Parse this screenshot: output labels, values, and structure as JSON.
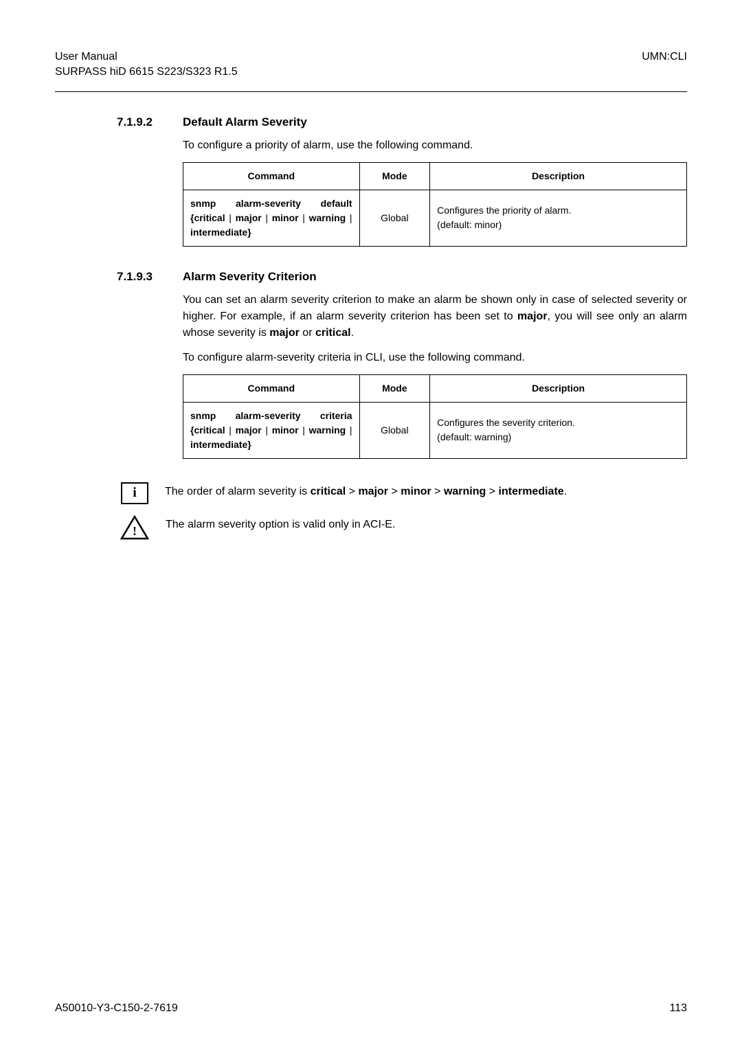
{
  "header": {
    "left_line1": "User Manual",
    "left_line2": "SURPASS hiD 6615 S223/S323 R1.5",
    "right": "UMN:CLI"
  },
  "section1": {
    "number": "7.1.9.2",
    "title": "Default Alarm Severity",
    "intro": "To configure a priority of alarm, use the following command.",
    "th_command": "Command",
    "th_mode": "Mode",
    "th_desc": "Description",
    "cmd_prefix": "snmp alarm-severity default {critical",
    "cmd_sep1": " | ",
    "cmd_major": "major",
    "cmd_sep2": " | ",
    "cmd_minor": "minor",
    "cmd_sep3": " | ",
    "cmd_warning": "warning",
    "cmd_sep4": " | ",
    "cmd_intermediate": "intermediate}",
    "mode": "Global",
    "desc_l1": "Configures the priority of alarm.",
    "desc_l2": "(default: minor)"
  },
  "section2": {
    "number": "7.1.9.3",
    "title": "Alarm Severity Criterion",
    "para1_a": "You can set an alarm severity criterion to make an alarm be shown only in case of selected severity or higher. For example, if an alarm severity criterion has been set to ",
    "para1_b": "major",
    "para1_c": ", you will see only an alarm whose severity is ",
    "para1_d": "major",
    "para1_e": " or ",
    "para1_f": "critical",
    "para1_g": ".",
    "para2": "To configure alarm-severity criteria in CLI, use the following command.",
    "th_command": "Command",
    "th_mode": "Mode",
    "th_desc": "Description",
    "cmd_prefix": "snmp alarm-severity criteria {critical",
    "cmd_sep1": " | ",
    "cmd_major": "major",
    "cmd_sep2": " | ",
    "cmd_minor": "minor",
    "cmd_sep3": " | ",
    "cmd_warning": "warning",
    "cmd_sep4": " | ",
    "cmd_intermediate": "intermediate}",
    "mode": "Global",
    "desc_l1": "Configures the severity criterion.",
    "desc_l2": "(default: warning)"
  },
  "notes": {
    "info_glyph": "i",
    "info_a": "The order of alarm severity is ",
    "info_b": "critical",
    "info_c": " > ",
    "info_d": "major",
    "info_e": " > ",
    "info_f": "minor",
    "info_g": " > ",
    "info_h": "warning",
    "info_i": " > ",
    "info_j": "intermediate",
    "info_k": ".",
    "warn_glyph": "!",
    "warn_text": "The alarm severity option is valid only in ACI-E."
  },
  "footer": {
    "left": "A50010-Y3-C150-2-7619",
    "right": "113"
  }
}
